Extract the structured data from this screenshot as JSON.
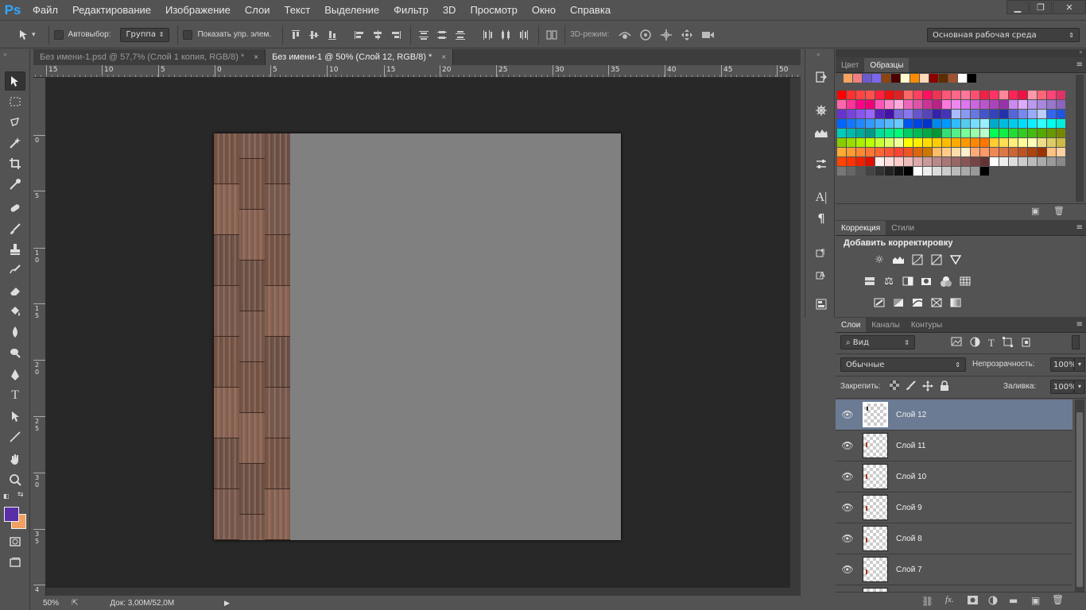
{
  "app": {
    "logo": "Ps"
  },
  "menu": [
    "Файл",
    "Редактирование",
    "Изображение",
    "Слои",
    "Текст",
    "Выделение",
    "Фильтр",
    "3D",
    "Просмотр",
    "Окно",
    "Справка"
  ],
  "window_controls": {
    "minimize": "▁",
    "restore": "❐",
    "close": "✕"
  },
  "options": {
    "autoselect_label": "Автовыбор:",
    "autoselect_mode": "Группа",
    "show_transform_label": "Показать упр. элем.",
    "mode3d_label": "3D-режим:",
    "workspace": "Основная рабочая среда"
  },
  "tabs": [
    {
      "label": "Без имени-1.psd @ 57,7% (Слой 1 копия, RGB/8) *",
      "close": "×",
      "active": false
    },
    {
      "label": "Без имени-1 @ 50% (Слой 12, RGB/8) *",
      "close": "×",
      "active": true
    }
  ],
  "ruler_top": [
    "15",
    "10",
    "5",
    "0",
    "5",
    "10",
    "15",
    "20",
    "25",
    "30",
    "35",
    "40",
    "45",
    "50"
  ],
  "ruler_left": [
    "0",
    "5",
    "1\n0",
    "1\n5",
    "2\n0",
    "2\n5",
    "3\n0",
    "3\n5",
    "4"
  ],
  "status": {
    "zoom": "50%",
    "doc": "Док: 3,00M/52,0M"
  },
  "panels": {
    "color_tab": "Цвет",
    "swatches_tab": "Образцы",
    "correction_tab": "Коррекция",
    "styles_tab": "Стили",
    "add_correction": "Добавить корректировку",
    "layers_tab": "Слои",
    "channels_tab": "Каналы",
    "paths_tab": "Контуры",
    "filter_kind": "Вид",
    "blend_mode": "Обычные",
    "opacity_label": "Непрозрачность:",
    "opacity_value": "100%",
    "lock_label": "Закрепить:",
    "fill_label": "Заливка:",
    "fill_value": "100%"
  },
  "layers": [
    {
      "name": "Слой 12",
      "selected": true
    },
    {
      "name": "Слой 11",
      "selected": false
    },
    {
      "name": "Слой 10",
      "selected": false
    },
    {
      "name": "Слой 9",
      "selected": false
    },
    {
      "name": "Слой 8",
      "selected": false
    },
    {
      "name": "Слой 7",
      "selected": false
    }
  ],
  "colors": {
    "foreground": "#5a2ea6",
    "background": "#f0a060",
    "selected_layer": "#6b7b93",
    "canvas_fill": "#808080"
  }
}
